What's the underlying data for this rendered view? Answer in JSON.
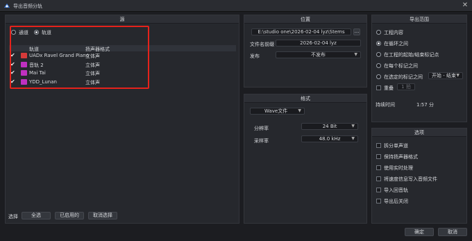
{
  "window": {
    "title": "导出音频分轨",
    "close_glyph": "✕"
  },
  "source": {
    "header": "源",
    "mode_channels": "通道",
    "mode_tracks": "轨道",
    "col_track": "轨道",
    "col_format": "扬声器格式",
    "tracks": [
      {
        "name": "UADx Ravel Grand Piano",
        "format": "立体声",
        "color": "#d63a3a"
      },
      {
        "name": "音轨 2",
        "format": "立体声",
        "color": "#c030c0"
      },
      {
        "name": "Mai Tai",
        "format": "立体声",
        "color": "#c030c0"
      },
      {
        "name": "YDD_Lunan",
        "format": "立体声",
        "color": "#c030c0"
      }
    ],
    "select_label": "选择",
    "btn_all": "全选",
    "btn_enabled": "已启用的",
    "btn_clear": "取消选择"
  },
  "location": {
    "header": "位置",
    "path": "E:\\studio one\\2026-02-04 lyz\\Stems",
    "browse": "...",
    "filename_label": "文件名前缀",
    "filename_value": "2026-02-04 lyz",
    "publish_label": "发布",
    "publish_value": "不发布"
  },
  "format": {
    "header": "格式",
    "type_value": "Wave文件",
    "resolution_label": "分辨率",
    "resolution_value": "24 Bit",
    "samplerate_label": "采样率",
    "samplerate_value": "48.0 kHz"
  },
  "range": {
    "header": "导出范围",
    "opt_song": "工程内容",
    "opt_loop": "在循环之间",
    "opt_start_end": "在工程的起始/结束标记点",
    "opt_each_marker": "在每个标记之间",
    "opt_selected_markers": "在选定的标记之间",
    "marker_select": "开始 - 结束",
    "repeat_label": "重叠",
    "repeat_value": "1 拍",
    "duration_label": "持续时间",
    "duration_value": "1:57 分"
  },
  "options": {
    "header": "选项",
    "items": [
      "拆分单声道",
      "保持扬声器格式",
      "使用实时处理",
      "将速度信息写入音频文件",
      "导入回音轨",
      "导出后关闭"
    ]
  },
  "footer": {
    "ok": "确定",
    "cancel": "取消"
  }
}
